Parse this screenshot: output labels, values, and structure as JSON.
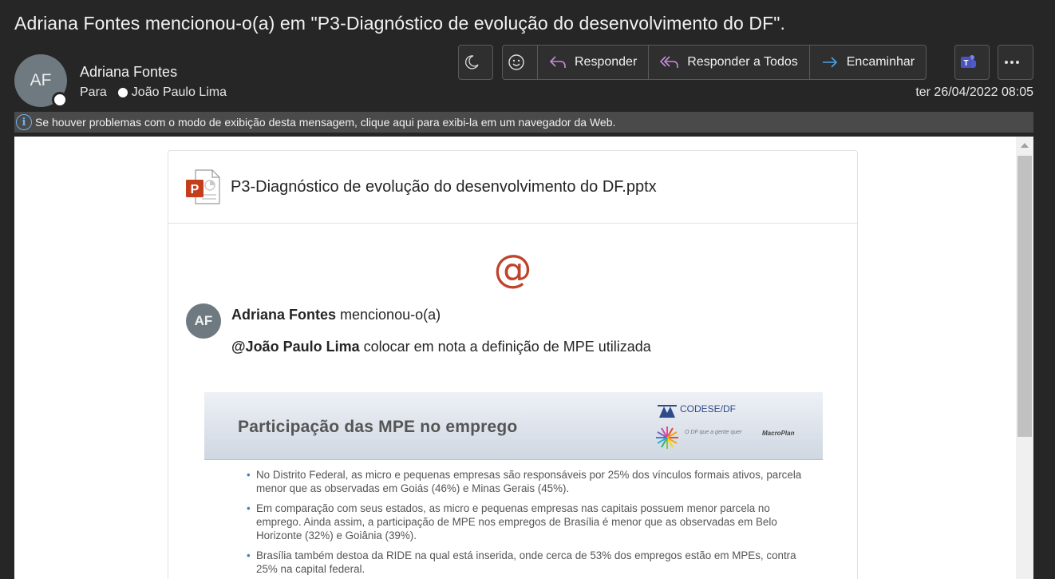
{
  "subject": "Adriana Fontes mencionou-o(a) em \"P3-Diagnóstico de evolução do desenvolvimento do DF\".",
  "sender": {
    "initials": "AF",
    "name": "Adriana Fontes"
  },
  "recipients": {
    "label": "Para",
    "name": "João Paulo Lima"
  },
  "toolbar": {
    "reply_label": "Responder",
    "reply_all_label": "Responder a Todos",
    "forward_label": "Encaminhar"
  },
  "date": "ter 26/04/2022 08:05",
  "infobar": {
    "text": "Se houver problemas com o modo de exibição desta mensagem, clique aqui para exibi-la em um navegador da Web."
  },
  "card": {
    "file_name": "P3-Diagnóstico de evolução do desenvolvimento do DF.pptx",
    "at_symbol": "@",
    "commenter_initials": "AF",
    "commenter_name": "Adriana Fontes",
    "mention_action": " mencionou-o(a)",
    "mentioned_user": "@João Paulo Lima",
    "comment_text": " colocar em nota a definição de MPE utilizada"
  },
  "slide": {
    "title": "Participação das MPE no emprego",
    "logo_text": "CODESE/DF",
    "tagline": "O DF que a gente quer",
    "partner": "MacroPlan",
    "bullets": [
      "No Distrito Federal, as micro e pequenas empresas são responsáveis por 25% dos vínculos formais ativos, parcela menor que as observadas em Goiás (46%) e Minas Gerais (45%).",
      "Em comparação com seus estados, as micro e pequenas empresas nas capitais possuem menor parcela no emprego. Ainda assim, a participação de MPE nos empregos de Brasília  é menor que as observadas em Belo Horizonte (32%) e Goiânia (39%).",
      "Brasília também destoa da RIDE na qual está inserida, onde cerca de 53% dos empregos estão em MPEs, contra 25% na capital federal."
    ]
  },
  "colors": {
    "background": "#262626",
    "accent_at": "#c0432c",
    "info_blue": "#6fb1ea"
  }
}
